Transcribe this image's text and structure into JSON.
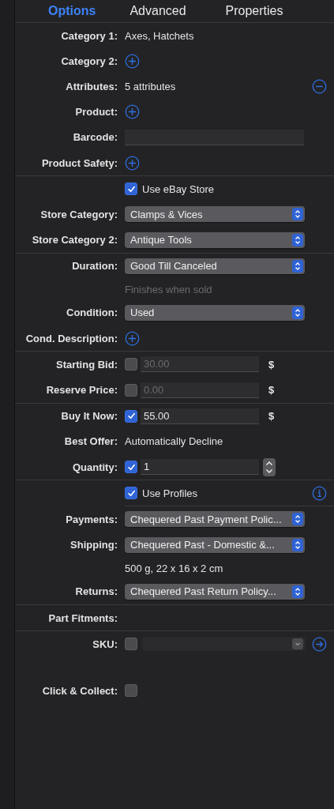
{
  "tabs": [
    {
      "label": "Options",
      "selected": true
    },
    {
      "label": "Advanced",
      "selected": false
    },
    {
      "label": "Properties",
      "selected": false
    }
  ],
  "rows": [
    {
      "kind": "text",
      "label": "Category 1:",
      "value": "Axes, Hatchets"
    },
    {
      "kind": "add",
      "label": "Category 2:"
    },
    {
      "kind": "text",
      "label": "Attributes:",
      "value": "5 attributes",
      "trailing": {
        "kind": "remove"
      }
    },
    {
      "kind": "add",
      "label": "Product:"
    },
    {
      "kind": "field",
      "label": "Barcode:"
    },
    {
      "kind": "add",
      "label": "Product Safety:"
    },
    {
      "kind": "divider"
    },
    {
      "kind": "check",
      "text": "Use eBay Store",
      "checked": true
    },
    {
      "kind": "popup",
      "label": "Store Category:",
      "value": "Clamps & Vices"
    },
    {
      "kind": "popup",
      "label": "Store Category 2:",
      "value": "Antique Tools"
    },
    {
      "kind": "divider"
    },
    {
      "kind": "popup",
      "label": "Duration:",
      "value": "Good Till Canceled"
    },
    {
      "kind": "note",
      "text": "Finishes when sold",
      "dim": true
    },
    {
      "kind": "popup",
      "label": "Condition:",
      "value": "Used"
    },
    {
      "kind": "add",
      "label": "Cond. Description:"
    },
    {
      "kind": "divider"
    },
    {
      "kind": "price",
      "label": "Starting Bid:",
      "checked": false,
      "value": "30.00",
      "currency": "$"
    },
    {
      "kind": "price",
      "label": "Reserve Price:",
      "checked": false,
      "value": "0.00",
      "currency": "$"
    },
    {
      "kind": "divider"
    },
    {
      "kind": "price",
      "label": "Buy It Now:",
      "checked": true,
      "value": "55.00",
      "currency": "$"
    },
    {
      "kind": "text",
      "label": "Best Offer:",
      "value": "Automatically Decline"
    },
    {
      "kind": "stepper",
      "label": "Quantity:",
      "checked": true,
      "value": "1"
    },
    {
      "kind": "divider"
    },
    {
      "kind": "check",
      "text": "Use Profiles",
      "checked": true,
      "trailing": {
        "kind": "info"
      }
    },
    {
      "kind": "divider",
      "inset": true
    },
    {
      "kind": "popup",
      "label": "Payments:",
      "value": "Chequered Past Payment Polic..."
    },
    {
      "kind": "popup",
      "label": "Shipping:",
      "value": "Chequered Past - Domestic &..."
    },
    {
      "kind": "note",
      "text": "500 g, 22 x 16 x 2 cm",
      "dim": false
    },
    {
      "kind": "popup",
      "label": "Returns:",
      "value": "Chequered Past Return Policy..."
    },
    {
      "kind": "divider"
    },
    {
      "kind": "label",
      "label": "Part Fitments:"
    },
    {
      "kind": "divider"
    },
    {
      "kind": "sku",
      "label": "SKU:",
      "checked": false,
      "trailing": {
        "kind": "go"
      }
    },
    {
      "kind": "labelcheck",
      "label": "Click & Collect:",
      "checked": false
    }
  ]
}
